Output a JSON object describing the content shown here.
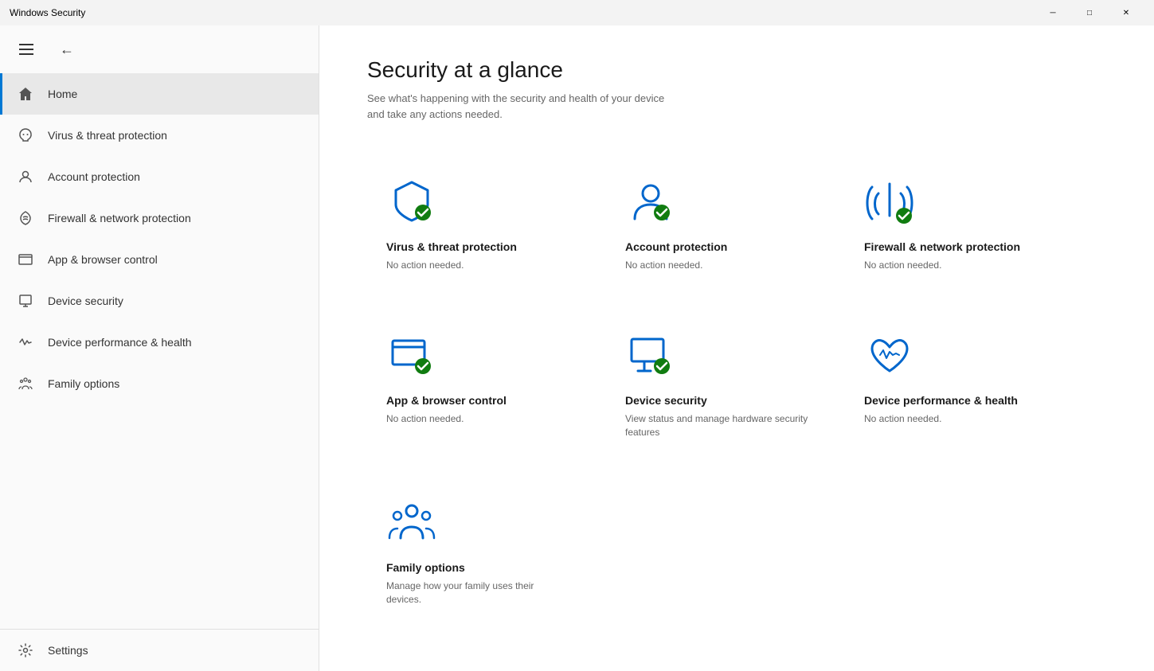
{
  "titlebar": {
    "title": "Windows Security",
    "minimize_label": "─",
    "maximize_label": "□",
    "close_label": "✕"
  },
  "sidebar": {
    "nav_items": [
      {
        "id": "home",
        "label": "Home",
        "icon": "home-icon",
        "active": true
      },
      {
        "id": "virus",
        "label": "Virus & threat protection",
        "icon": "virus-icon",
        "active": false
      },
      {
        "id": "account",
        "label": "Account protection",
        "icon": "account-icon",
        "active": false
      },
      {
        "id": "firewall",
        "label": "Firewall & network protection",
        "icon": "firewall-icon",
        "active": false
      },
      {
        "id": "app-browser",
        "label": "App & browser control",
        "icon": "app-browser-icon",
        "active": false
      },
      {
        "id": "device-security",
        "label": "Device security",
        "icon": "device-security-icon",
        "active": false
      },
      {
        "id": "device-health",
        "label": "Device performance & health",
        "icon": "device-health-icon",
        "active": false
      },
      {
        "id": "family",
        "label": "Family options",
        "icon": "family-icon",
        "active": false
      }
    ],
    "settings_label": "Settings"
  },
  "main": {
    "title": "Security at a glance",
    "subtitle": "See what's happening with the security and health of your device\nand take any actions needed.",
    "cards": [
      {
        "id": "virus",
        "title": "Virus & threat protection",
        "desc": "No action needed.",
        "has_check": true
      },
      {
        "id": "account",
        "title": "Account protection",
        "desc": "No action needed.",
        "has_check": true
      },
      {
        "id": "firewall",
        "title": "Firewall & network protection",
        "desc": "No action needed.",
        "has_check": true
      },
      {
        "id": "app-browser",
        "title": "App & browser control",
        "desc": "No action needed.",
        "has_check": true
      },
      {
        "id": "device-security",
        "title": "Device security",
        "desc": "View status and manage hardware security features",
        "has_check": true
      },
      {
        "id": "device-health",
        "title": "Device performance & health",
        "desc": "No action needed.",
        "has_check": false
      },
      {
        "id": "family",
        "title": "Family options",
        "desc": "Manage how your family uses their devices.",
        "has_check": false
      }
    ]
  }
}
